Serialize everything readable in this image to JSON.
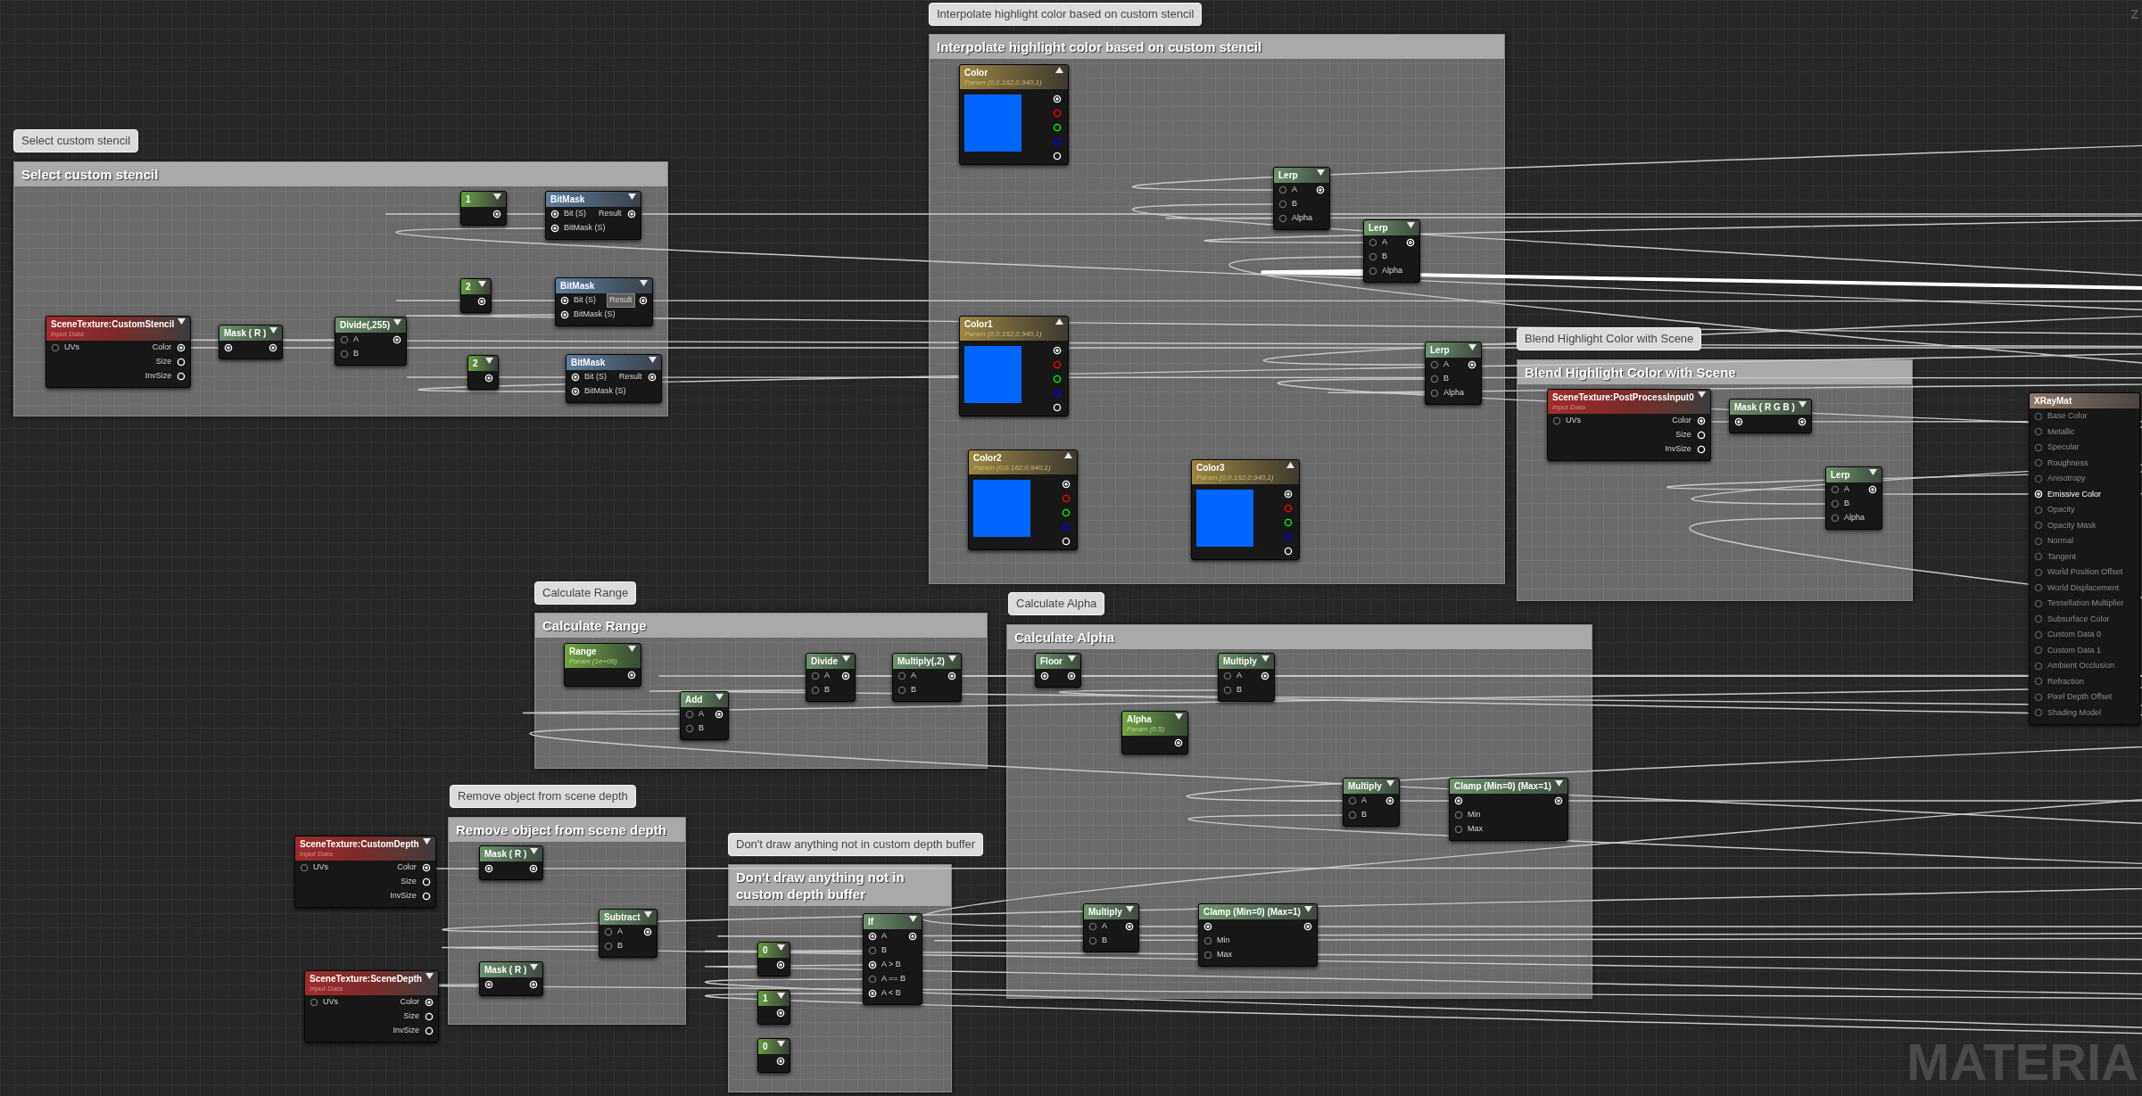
{
  "comments": [
    {
      "bubble": "Interpolate highlight color based on custom stencil",
      "title": "Interpolate highlight color based on custom stencil"
    },
    {
      "bubble": "Select custom stencil",
      "title": "Select custom stencil"
    },
    {
      "bubble": "Blend Highlight Color with Scene",
      "title": "Blend Highlight Color with Scene"
    },
    {
      "bubble": "Calculate Range",
      "title": "Calculate Range"
    },
    {
      "bubble": "Calculate Alpha",
      "title": "Calculate Alpha"
    },
    {
      "bubble": "Remove object from scene depth",
      "title": "Remove object from scene depth"
    },
    {
      "bubble": "Don't draw anything not in custom depth buffer",
      "title": "Don't draw anything not in custom depth buffer"
    }
  ],
  "nodes": [
    {
      "kind": "texture",
      "title": "SceneTexture:CustomStencil",
      "subtitle": "Input Data",
      "inputs": [
        {
          "label": "UVs",
          "connected": false
        }
      ],
      "outputs": [
        {
          "label": "Color",
          "connected": true
        },
        {
          "label": "Size",
          "connected": false
        },
        {
          "label": "InvSize",
          "connected": false
        }
      ]
    },
    {
      "kind": "math",
      "title": "Mask ( R )",
      "inputs": [
        {
          "connected": true
        }
      ],
      "outputs": [
        {
          "connected": true
        }
      ]
    },
    {
      "kind": "math",
      "title": "Divide(,255)",
      "inputs": [
        {
          "label": "A",
          "connected": false
        },
        {
          "label": "B",
          "connected": false
        }
      ],
      "outputs": [
        {
          "connected": true
        }
      ]
    },
    {
      "kind": "constant",
      "title": "1",
      "outputs": [
        {
          "connected": true
        }
      ]
    },
    {
      "kind": "constant",
      "title": "2",
      "outputs": [
        {
          "connected": true
        }
      ]
    },
    {
      "kind": "constant",
      "title": "2",
      "outputs": [
        {
          "connected": true
        }
      ]
    },
    {
      "kind": "bitmask",
      "title": "BitMask",
      "inputs": [
        {
          "label": "Bit (S)",
          "connected": true
        },
        {
          "label": "BitMask (S)",
          "connected": true
        }
      ],
      "outputs": [
        {
          "label": "Result",
          "connected": true,
          "highlighted": false
        }
      ]
    },
    {
      "kind": "bitmask",
      "title": "BitMask",
      "inputs": [
        {
          "label": "Bit (S)",
          "connected": true
        },
        {
          "label": "BitMask (S)",
          "connected": true
        }
      ],
      "outputs": [
        {
          "label": "Result",
          "connected": true,
          "highlighted": true
        }
      ]
    },
    {
      "kind": "bitmask",
      "title": "BitMask",
      "inputs": [
        {
          "label": "Bit (S)",
          "connected": true
        },
        {
          "label": "BitMask (S)",
          "connected": true
        }
      ],
      "outputs": [
        {
          "label": "Result",
          "connected": true,
          "highlighted": false
        }
      ]
    },
    {
      "kind": "vector_param",
      "title": "Color",
      "subtitle": "Param (0,0.162,0.940,1)",
      "outputs": [
        {
          "color": "#ffffff",
          "connected": true
        },
        {
          "color": "#ff0000",
          "connected": false
        },
        {
          "color": "#00ff00",
          "connected": false
        },
        {
          "color": "#0000ff",
          "connected": false
        },
        {
          "color": "#ffffff",
          "connected": false
        }
      ]
    },
    {
      "kind": "vector_param",
      "title": "Color1",
      "subtitle": "Param (0,0.162,0.940,1)",
      "outputs": [
        {
          "color": "#ffffff",
          "connected": true
        },
        {
          "color": "#ff0000",
          "connected": false
        },
        {
          "color": "#00ff00",
          "connected": false
        },
        {
          "color": "#0000ff",
          "connected": false
        },
        {
          "color": "#ffffff",
          "connected": false
        }
      ]
    },
    {
      "kind": "vector_param",
      "title": "Color2",
      "subtitle": "Param (0,0.162,0.940,1)",
      "outputs": [
        {
          "color": "#ffffff",
          "connected": true
        },
        {
          "color": "#ff0000",
          "connected": false
        },
        {
          "color": "#00ff00",
          "connected": false
        },
        {
          "color": "#0000ff",
          "connected": false
        },
        {
          "color": "#ffffff",
          "connected": false
        }
      ]
    },
    {
      "kind": "vector_param",
      "title": "Color3",
      "subtitle": "Param (0,0.162,0.940,1)",
      "outputs": [
        {
          "color": "#ffffff",
          "connected": true
        },
        {
          "color": "#ff0000",
          "connected": false
        },
        {
          "color": "#00ff00",
          "connected": false
        },
        {
          "color": "#0000ff",
          "connected": false
        },
        {
          "color": "#ffffff",
          "connected": false
        }
      ]
    },
    {
      "kind": "math",
      "title": "Lerp",
      "inputs": [
        {
          "label": "A",
          "connected": false
        },
        {
          "label": "B",
          "connected": false
        },
        {
          "label": "Alpha",
          "connected": false
        }
      ],
      "outputs": [
        {
          "connected": true
        }
      ]
    },
    {
      "kind": "math",
      "title": "Lerp",
      "inputs": [
        {
          "label": "A",
          "connected": false
        },
        {
          "label": "B",
          "connected": false
        },
        {
          "label": "Alpha",
          "connected": false
        }
      ],
      "outputs": [
        {
          "connected": true
        }
      ]
    },
    {
      "kind": "math",
      "title": "Lerp",
      "inputs": [
        {
          "label": "A",
          "connected": false
        },
        {
          "label": "B",
          "connected": false
        },
        {
          "label": "Alpha",
          "connected": false
        }
      ],
      "outputs": [
        {
          "connected": true
        }
      ]
    },
    {
      "kind": "texture",
      "title": "SceneTexture:PostProcessInput0",
      "subtitle": "Input Data",
      "inputs": [
        {
          "label": "UVs",
          "connected": false
        }
      ],
      "outputs": [
        {
          "label": "Color",
          "connected": true
        },
        {
          "label": "Size",
          "connected": false
        },
        {
          "label": "InvSize",
          "connected": false
        }
      ]
    },
    {
      "kind": "math",
      "title": "Mask ( R G B )",
      "inputs": [
        {
          "connected": true
        }
      ],
      "outputs": [
        {
          "connected": true
        }
      ]
    },
    {
      "kind": "math",
      "title": "Lerp",
      "inputs": [
        {
          "label": "A",
          "connected": false
        },
        {
          "label": "B",
          "connected": false
        },
        {
          "label": "Alpha",
          "connected": false
        }
      ],
      "outputs": [
        {
          "connected": true
        }
      ]
    },
    {
      "kind": "result",
      "title": "XRayMat",
      "inputs": [
        {
          "label": "Base Color",
          "connected": false
        },
        {
          "label": "Metallic",
          "connected": false
        },
        {
          "label": "Specular",
          "connected": false
        },
        {
          "label": "Roughness",
          "connected": false
        },
        {
          "label": "Anisotropy",
          "connected": false
        },
        {
          "label": "Emissive Color",
          "connected": true
        },
        {
          "label": "Opacity",
          "connected": false
        },
        {
          "label": "Opacity Mask",
          "connected": false
        },
        {
          "label": "Normal",
          "connected": false
        },
        {
          "label": "Tangent",
          "connected": false
        },
        {
          "label": "World Position Offset",
          "connected": false
        },
        {
          "label": "World Displacement",
          "connected": false
        },
        {
          "label": "Tessellation Multiplier",
          "connected": false
        },
        {
          "label": "Subsurface Color",
          "connected": false
        },
        {
          "label": "Custom Data 0",
          "connected": false
        },
        {
          "label": "Custom Data 1",
          "connected": false
        },
        {
          "label": "Ambient Occlusion",
          "connected": false
        },
        {
          "label": "Refraction",
          "connected": false
        },
        {
          "label": "Pixel Depth Offset",
          "connected": false
        },
        {
          "label": "Shading Model",
          "connected": false
        }
      ]
    },
    {
      "kind": "scalar_param",
      "title": "Range",
      "subtitle": "Param (1e+06)",
      "outputs": [
        {
          "connected": true
        }
      ]
    },
    {
      "kind": "math",
      "title": "Add",
      "inputs": [
        {
          "label": "A",
          "connected": false
        },
        {
          "label": "B",
          "connected": false
        }
      ],
      "outputs": [
        {
          "connected": true
        }
      ]
    },
    {
      "kind": "math",
      "title": "Divide",
      "inputs": [
        {
          "label": "A",
          "connected": false
        },
        {
          "label": "B",
          "connected": false
        }
      ],
      "outputs": [
        {
          "connected": true
        }
      ]
    },
    {
      "kind": "math",
      "title": "Multiply(,2)",
      "inputs": [
        {
          "label": "A",
          "connected": false
        },
        {
          "label": "B",
          "connected": false
        }
      ],
      "outputs": [
        {
          "connected": true
        }
      ]
    },
    {
      "kind": "texture",
      "title": "SceneTexture:CustomDepth",
      "subtitle": "Input Data",
      "inputs": [
        {
          "label": "UVs",
          "connected": false
        }
      ],
      "outputs": [
        {
          "label": "Color",
          "connected": true
        },
        {
          "label": "Size",
          "connected": false
        },
        {
          "label": "InvSize",
          "connected": false
        }
      ]
    },
    {
      "kind": "texture",
      "title": "SceneTexture:SceneDepth",
      "subtitle": "Input Data",
      "inputs": [
        {
          "label": "UVs",
          "connected": false
        }
      ],
      "outputs": [
        {
          "label": "Color",
          "connected": true
        },
        {
          "label": "Size",
          "connected": false
        },
        {
          "label": "InvSize",
          "connected": false
        }
      ]
    },
    {
      "kind": "math",
      "title": "Mask ( R )",
      "inputs": [
        {
          "connected": true
        }
      ],
      "outputs": [
        {
          "connected": true
        }
      ]
    },
    {
      "kind": "math",
      "title": "Mask ( R )",
      "inputs": [
        {
          "connected": true
        }
      ],
      "outputs": [
        {
          "connected": true
        }
      ]
    },
    {
      "kind": "math",
      "title": "Subtract",
      "inputs": [
        {
          "label": "A",
          "connected": false
        },
        {
          "label": "B",
          "connected": false
        }
      ],
      "outputs": [
        {
          "connected": true
        }
      ]
    },
    {
      "kind": "math",
      "title": "If",
      "inputs": [
        {
          "label": "A",
          "connected": true
        },
        {
          "label": "B",
          "connected": false
        },
        {
          "label": "A > B",
          "connected": true
        },
        {
          "label": "A == B",
          "connected": false
        },
        {
          "label": "A < B",
          "connected": true
        }
      ],
      "outputs": [
        {
          "connected": true
        }
      ]
    },
    {
      "kind": "constant",
      "title": "0",
      "outputs": [
        {
          "connected": true
        }
      ]
    },
    {
      "kind": "constant",
      "title": "1",
      "outputs": [
        {
          "connected": true
        }
      ]
    },
    {
      "kind": "constant",
      "title": "0",
      "outputs": [
        {
          "connected": true
        }
      ]
    },
    {
      "kind": "math",
      "title": "Floor",
      "inputs": [
        {
          "connected": true
        }
      ],
      "outputs": [
        {
          "connected": true
        }
      ]
    },
    {
      "kind": "math",
      "title": "Multiply",
      "inputs": [
        {
          "label": "A",
          "connected": false
        },
        {
          "label": "B",
          "connected": false
        }
      ],
      "outputs": [
        {
          "connected": true
        }
      ]
    },
    {
      "kind": "scalar_param",
      "title": "Alpha",
      "subtitle": "Param (0.5)",
      "outputs": [
        {
          "connected": true
        }
      ]
    },
    {
      "kind": "math",
      "title": "Multiply",
      "inputs": [
        {
          "label": "A",
          "connected": false
        },
        {
          "label": "B",
          "connected": false
        }
      ],
      "outputs": [
        {
          "connected": true
        }
      ]
    },
    {
      "kind": "math",
      "title": "Clamp (Min=0) (Max=1)",
      "inputs": [
        {
          "connected": true
        },
        {
          "label": "Min",
          "connected": false
        },
        {
          "label": "Max",
          "connected": false
        }
      ],
      "outputs": [
        {
          "connected": true
        }
      ]
    },
    {
      "kind": "math",
      "title": "Multiply",
      "inputs": [
        {
          "label": "A",
          "connected": false
        },
        {
          "label": "B",
          "connected": false
        }
      ],
      "outputs": [
        {
          "connected": true
        }
      ]
    },
    {
      "kind": "math",
      "title": "Clamp (Min=0) (Max=1)",
      "inputs": [
        {
          "connected": true
        },
        {
          "label": "Min",
          "connected": false
        },
        {
          "label": "Max",
          "connected": false
        }
      ],
      "outputs": [
        {
          "connected": true
        }
      ]
    }
  ],
  "zoom_label": "Z",
  "corner_label": "MATERIA"
}
